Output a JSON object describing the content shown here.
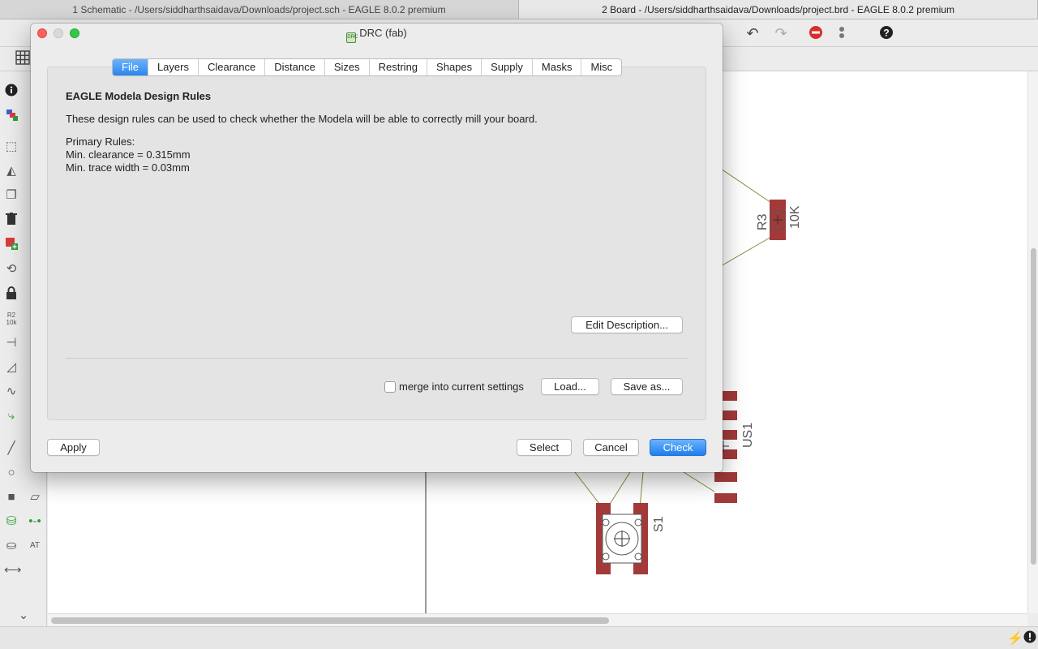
{
  "window_tabs": [
    {
      "label": "1 Schematic - /Users/siddharthsaidava/Downloads/project.sch - EAGLE 8.0.2 premium"
    },
    {
      "label": "2 Board - /Users/siddharthsaidava/Downloads/project.brd - EAGLE 8.0.2 premium"
    }
  ],
  "canvas": {
    "labels": {
      "r3": "R3",
      "r3_value": "10K",
      "us1": "US1",
      "s1": "S1"
    }
  },
  "dialog": {
    "title": "DRC (fab)",
    "tabs": [
      "File",
      "Layers",
      "Clearance",
      "Distance",
      "Sizes",
      "Restring",
      "Shapes",
      "Supply",
      "Masks",
      "Misc"
    ],
    "selected_tab": "File",
    "file": {
      "heading": "EAGLE Modela Design Rules",
      "description": "These design rules can be used to check whether the Modela will be able to correctly mill your board.",
      "rules": [
        "Primary Rules:",
        "Min. clearance = 0.315mm",
        "Min. trace width = 0.03mm"
      ],
      "edit_description_label": "Edit Description...",
      "merge_label": "merge into current settings",
      "merge_checked": false,
      "load_label": "Load...",
      "save_as_label": "Save as..."
    },
    "buttons": {
      "apply": "Apply",
      "select": "Select",
      "cancel": "Cancel",
      "check": "Check"
    }
  },
  "colors": {
    "accent": "#2a85f0",
    "pad": "#a33a3a",
    "airwire": "#8a8a3a"
  }
}
